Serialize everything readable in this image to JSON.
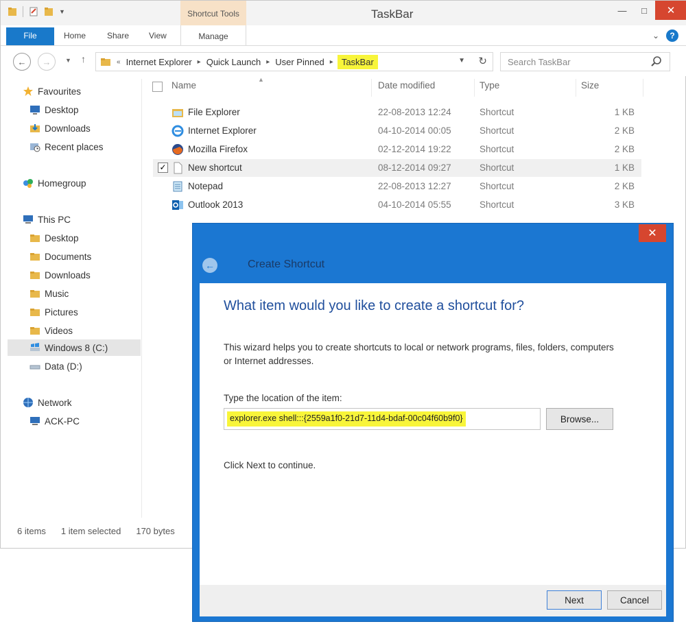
{
  "window": {
    "title": "TaskBar",
    "contextual_tab_group": "Shortcut Tools"
  },
  "ribbon": {
    "tabs": [
      "File",
      "Home",
      "Share",
      "View",
      "Manage"
    ]
  },
  "address_bar": {
    "crumbs": [
      "Internet Explorer",
      "Quick Launch",
      "User Pinned",
      "TaskBar"
    ],
    "highlight_color": "#f8f53a"
  },
  "search": {
    "placeholder": "Search TaskBar"
  },
  "sidebar": {
    "items": [
      {
        "label": "Favourites",
        "icon": "star-icon"
      },
      {
        "label": "Desktop",
        "icon": "desktop-icon"
      },
      {
        "label": "Downloads",
        "icon": "downloads-icon"
      },
      {
        "label": "Recent places",
        "icon": "recent-places-icon"
      },
      {
        "label": "Homegroup",
        "icon": "homegroup-icon"
      },
      {
        "label": "This PC",
        "icon": "computer-icon"
      },
      {
        "label": "Desktop",
        "icon": "folder-icon"
      },
      {
        "label": "Documents",
        "icon": "folder-icon"
      },
      {
        "label": "Downloads",
        "icon": "folder-icon"
      },
      {
        "label": "Music",
        "icon": "folder-icon"
      },
      {
        "label": "Pictures",
        "icon": "folder-icon"
      },
      {
        "label": "Videos",
        "icon": "folder-icon"
      },
      {
        "label": "Windows 8 (C:)",
        "icon": "drive-icon"
      },
      {
        "label": "Data (D:)",
        "icon": "drive-icon"
      },
      {
        "label": "Network",
        "icon": "network-icon"
      },
      {
        "label": "ACK-PC",
        "icon": "computer-icon"
      }
    ]
  },
  "file_list": {
    "columns": [
      "Name",
      "Date modified",
      "Type",
      "Size"
    ],
    "rows": [
      {
        "name": "File Explorer",
        "date": "22-08-2013 12:24",
        "type": "Shortcut",
        "size": "1 KB"
      },
      {
        "name": "Internet Explorer",
        "date": "04-10-2014 00:05",
        "type": "Shortcut",
        "size": "2 KB"
      },
      {
        "name": "Mozilla Firefox",
        "date": "02-12-2014 19:22",
        "type": "Shortcut",
        "size": "2 KB"
      },
      {
        "name": "New shortcut",
        "date": "08-12-2014 09:27",
        "type": "Shortcut",
        "size": "1 KB"
      },
      {
        "name": "Notepad",
        "date": "22-08-2013 12:27",
        "type": "Shortcut",
        "size": "2 KB"
      },
      {
        "name": "Outlook 2013",
        "date": "04-10-2014 05:55",
        "type": "Shortcut",
        "size": "3 KB"
      }
    ]
  },
  "status_bar": {
    "item_count": "6 items",
    "selection": "1 item selected",
    "size": "170 bytes"
  },
  "dialog": {
    "title": "Create Shortcut",
    "heading": "What item would you like to create a shortcut for?",
    "description": "This wizard helps you to create shortcuts to local or network programs, files, folders, computers or Internet addresses.",
    "location_label": "Type the location of the item:",
    "location_value": "explorer.exe shell:::{2559a1f0-21d7-11d4-bdaf-00c04f60b9f0}",
    "browse_label": "Browse...",
    "hint": "Click Next to continue.",
    "next_label": "Next",
    "cancel_label": "Cancel"
  }
}
